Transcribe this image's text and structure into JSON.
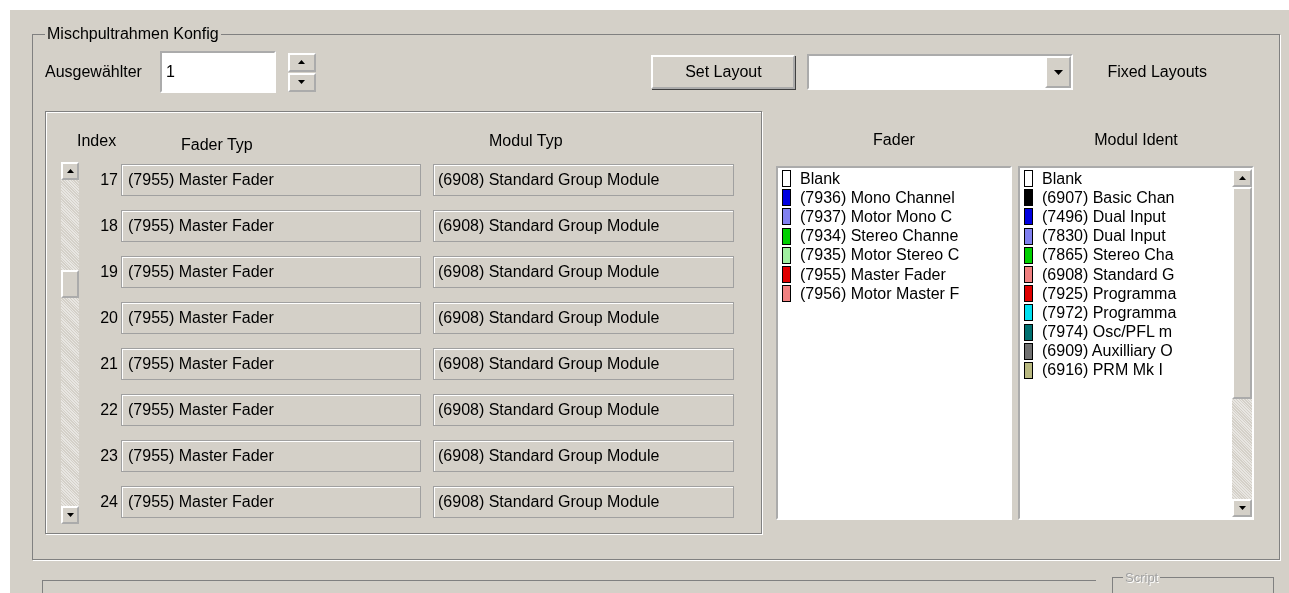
{
  "group": {
    "title": "Mischpultrahmen Konfig"
  },
  "selector": {
    "label": "Ausgewählter",
    "value": "1"
  },
  "set_layout_button": "Set Layout",
  "fixed_layouts": {
    "label": "Fixed Layouts"
  },
  "table": {
    "columns": [
      "Index",
      "Fader Typ",
      "Modul Typ"
    ],
    "rows": [
      {
        "index": "17",
        "fader": "(7955) Master Fader",
        "modul": "(6908) Standard Group Module"
      },
      {
        "index": "18",
        "fader": "(7955) Master Fader",
        "modul": "(6908) Standard Group Module"
      },
      {
        "index": "19",
        "fader": "(7955) Master Fader",
        "modul": "(6908) Standard Group Module"
      },
      {
        "index": "20",
        "fader": "(7955) Master Fader",
        "modul": "(6908) Standard Group Module"
      },
      {
        "index": "21",
        "fader": "(7955) Master Fader",
        "modul": "(6908) Standard Group Module"
      },
      {
        "index": "22",
        "fader": "(7955) Master Fader",
        "modul": "(6908) Standard Group Module"
      },
      {
        "index": "23",
        "fader": "(7955) Master Fader",
        "modul": "(6908) Standard Group Module"
      },
      {
        "index": "24",
        "fader": "(7955) Master Fader",
        "modul": "(6908) Standard Group Module"
      }
    ]
  },
  "fader_list": {
    "title": "Fader",
    "items": [
      {
        "label": "Blank",
        "color": "#ffffff"
      },
      {
        "label": "(7936) Mono Channel",
        "color": "#0000e0"
      },
      {
        "label": "(7937) Motor Mono C",
        "color": "#8080f0"
      },
      {
        "label": "(7934) Stereo Channe",
        "color": "#00d000"
      },
      {
        "label": "(7935) Motor Stereo C",
        "color": "#a0f0a0"
      },
      {
        "label": "(7955) Master Fader",
        "color": "#e00000"
      },
      {
        "label": "(7956) Motor Master F",
        "color": "#f08080"
      }
    ]
  },
  "modul_list": {
    "title": "Modul Ident",
    "items": [
      {
        "label": "Blank",
        "color": "#ffffff"
      },
      {
        "label": "(6907) Basic Chan",
        "color": "#000000"
      },
      {
        "label": "(7496) Dual Input",
        "color": "#0000e0"
      },
      {
        "label": "(7830) Dual Input",
        "color": "#8080f0"
      },
      {
        "label": "(7865) Stereo Cha",
        "color": "#00d000"
      },
      {
        "label": "(6908) Standard G",
        "color": "#f08080"
      },
      {
        "label": "(7925) Programma",
        "color": "#e00000"
      },
      {
        "label": "(7972) Programma",
        "color": "#00e0f0"
      },
      {
        "label": "(7974) Osc/PFL m",
        "color": "#007070"
      },
      {
        "label": "(6909) Auxilliary O",
        "color": "#707070"
      },
      {
        "label": "(6916) PRM Mk I",
        "color": "#b8b880"
      }
    ]
  },
  "script_group": {
    "title": "Script"
  }
}
